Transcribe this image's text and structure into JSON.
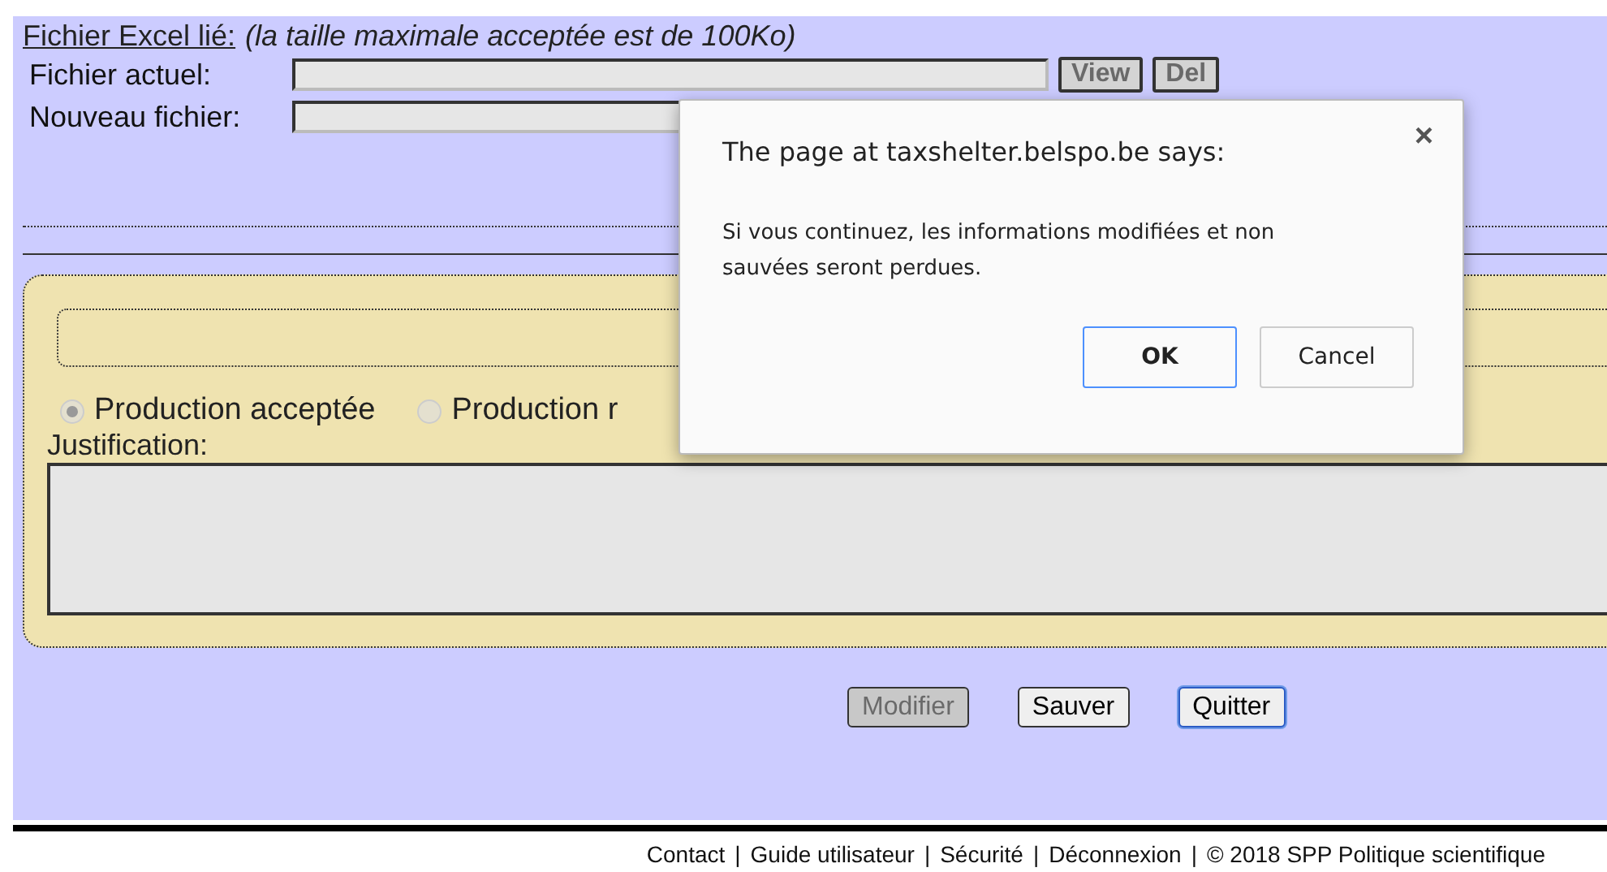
{
  "excel_section": {
    "heading": "Fichier Excel lié:",
    "note": "(la taille maximale acceptée est de 100Ko)",
    "fields": [
      {
        "label": "Fichier actuel:",
        "buttons": [
          {
            "label": "View",
            "disabled": true
          },
          {
            "label": "Del",
            "disabled": true
          }
        ]
      },
      {
        "label": "Nouveau fichier:"
      }
    ]
  },
  "decision_panel": {
    "options": [
      {
        "label": "Production acceptée",
        "selected": true
      },
      {
        "label": "Production r",
        "selected": false
      }
    ],
    "justification_label": "Justification:"
  },
  "actions": [
    {
      "label": "Modifier",
      "disabled": true,
      "focused": false
    },
    {
      "label": "Sauver",
      "disabled": false,
      "focused": false
    },
    {
      "label": "Quitter",
      "disabled": false,
      "focused": true
    }
  ],
  "footer": {
    "links": [
      "Contact",
      "Guide utilisateur",
      "Sécurité",
      "Déconnexion"
    ],
    "separator": "|",
    "copyright": "© 2018 SPP Politique scientifique"
  },
  "dialog": {
    "title": "The page at taxshelter.belspo.be says:",
    "close": "×",
    "message": "Si vous continuez, les informations modifiées et non sauvées seront perdues.",
    "buttons": [
      {
        "label": "OK",
        "kind": "primary"
      },
      {
        "label": "Cancel",
        "kind": "secondary"
      }
    ]
  }
}
